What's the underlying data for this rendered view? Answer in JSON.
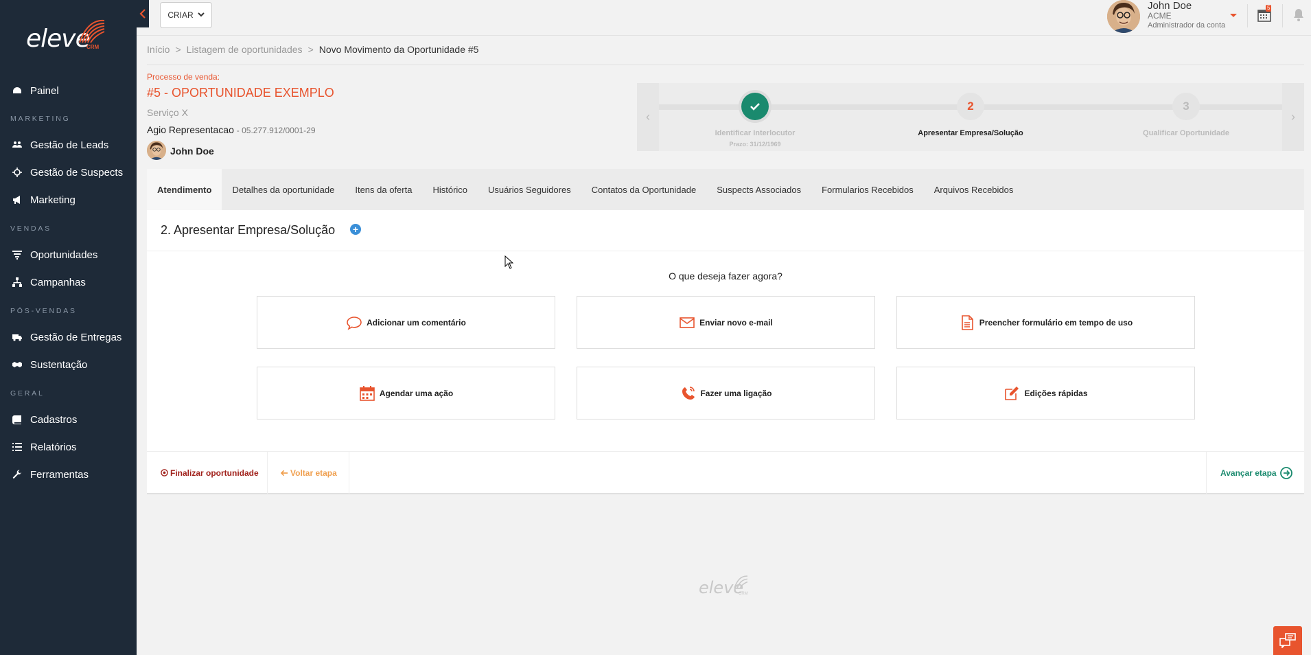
{
  "sidebar": {
    "logo_word": "eleve",
    "logo_sub": "CRM",
    "items": [
      {
        "label": "Painel"
      },
      {
        "section": "MARKETING"
      },
      {
        "label": "Gestão de Leads"
      },
      {
        "label": "Gestão de Suspects"
      },
      {
        "label": "Marketing"
      },
      {
        "section": "VENDAS"
      },
      {
        "label": "Oportunidades"
      },
      {
        "label": "Campanhas"
      },
      {
        "section": "PÓS-VENDAS"
      },
      {
        "label": "Gestão de Entregas"
      },
      {
        "label": "Sustentação"
      },
      {
        "section": "GERAL"
      },
      {
        "label": "Cadastros"
      },
      {
        "label": "Relatórios"
      },
      {
        "label": "Ferramentas"
      }
    ]
  },
  "topbar": {
    "create_label": "CRIAR",
    "user": {
      "name": "John Doe",
      "company": "ACME",
      "role": "Administrador da conta"
    },
    "calendar_badge": "5"
  },
  "breadcrumb": {
    "home": "Início",
    "list": "Listagem de oportunidades",
    "current": "Novo Movimento da Oportunidade #5"
  },
  "opportunity": {
    "process_label": "Processo de venda:",
    "title": "#5 - OPORTUNIDADE EXEMPLO",
    "service": "Serviço X",
    "company": "Agio Representacao",
    "cnpj": "- 05.277.912/0001-29",
    "owner": "John Doe"
  },
  "stepper": {
    "steps": [
      {
        "number": "1",
        "label": "Identificar Interlocutor",
        "sub": "Prazo: 31/12/1969",
        "state": "done"
      },
      {
        "number": "2",
        "label": "Apresentar Empresa/Solução",
        "state": "current"
      },
      {
        "number": "3",
        "label": "Qualificar Oportunidade",
        "state": "pending"
      }
    ]
  },
  "tabs": [
    "Atendimento",
    "Detalhes da oportunidade",
    "Itens da oferta",
    "Histórico",
    "Usuários Seguidores",
    "Contatos da Oportunidade",
    "Suspects Associados",
    "Formularios Recebidos",
    "Arquivos Recebidos"
  ],
  "panel": {
    "title": "2. Apresentar Empresa/Solução",
    "question": "O que deseja fazer agora?",
    "actions": [
      {
        "label": "Adicionar um comentário",
        "icon": "comment-icon"
      },
      {
        "label": "Enviar novo e-mail",
        "icon": "envelope-icon"
      },
      {
        "label": "Preencher formulário em tempo de uso",
        "icon": "document-icon"
      },
      {
        "label": "Agendar uma ação",
        "icon": "calendar-icon"
      },
      {
        "label": "Fazer uma ligação",
        "icon": "phone-icon"
      },
      {
        "label": "Edições rápidas",
        "icon": "edit-icon"
      }
    ],
    "footer": {
      "finalize": "Finalizar oportunidade",
      "back": "Voltar etapa",
      "advance": "Avançar etapa"
    }
  },
  "colors": {
    "accent": "#e8542e",
    "sidebar": "#1e2a38",
    "success": "#1a8a6e",
    "back": "#f0a050",
    "finalize": "#a0201a"
  }
}
